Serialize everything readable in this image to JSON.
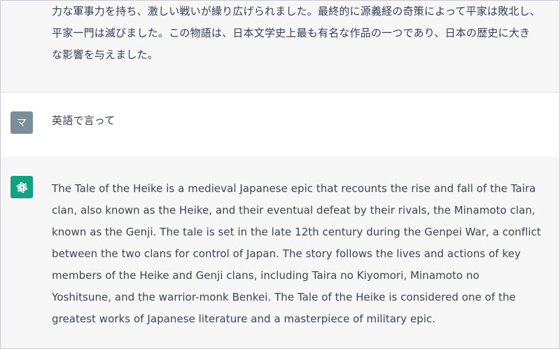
{
  "conversation": {
    "previous_response": {
      "lines": [
        "力な軍事力を持ち、激しい戦いが繰り広げられました。最終的に源義経の奇策によって平家は敗北し、",
        "平家一門は滅びました。この物語は、日本文学史上最も有名な作品の一つであり、日本の歴史に大き",
        "な影響を与えました。"
      ]
    },
    "user_message": {
      "avatar_initial": "マ",
      "text": "英語で言って"
    },
    "assistant_response": {
      "avatar_icon": "openai-logo-icon",
      "lines": [
        "The Tale of the Heike is a medieval Japanese epic that recounts the rise and fall of the Taira",
        "clan, also known as the Heike, and their eventual defeat by their rivals, the Minamoto clan,",
        "known as the Genji. The tale is set in the late 12th century during the Genpei War, a conflict",
        "between the two clans for control of Japan. The story follows the lives and actions of key",
        "members of the Heike and Genji clans, including Taira no Kiyomori, Minamoto no",
        "Yoshitsune, and the warrior-monk Benkei. The Tale of the Heike is considered one of the",
        "greatest works of Japanese literature and a masterpiece of military epic."
      ]
    }
  },
  "colors": {
    "assistant_bg": "#f7f7f8",
    "user_bg": "#ffffff",
    "user_avatar": "#7a8e9c",
    "bot_avatar": "#10a37f",
    "text": "#374151"
  }
}
